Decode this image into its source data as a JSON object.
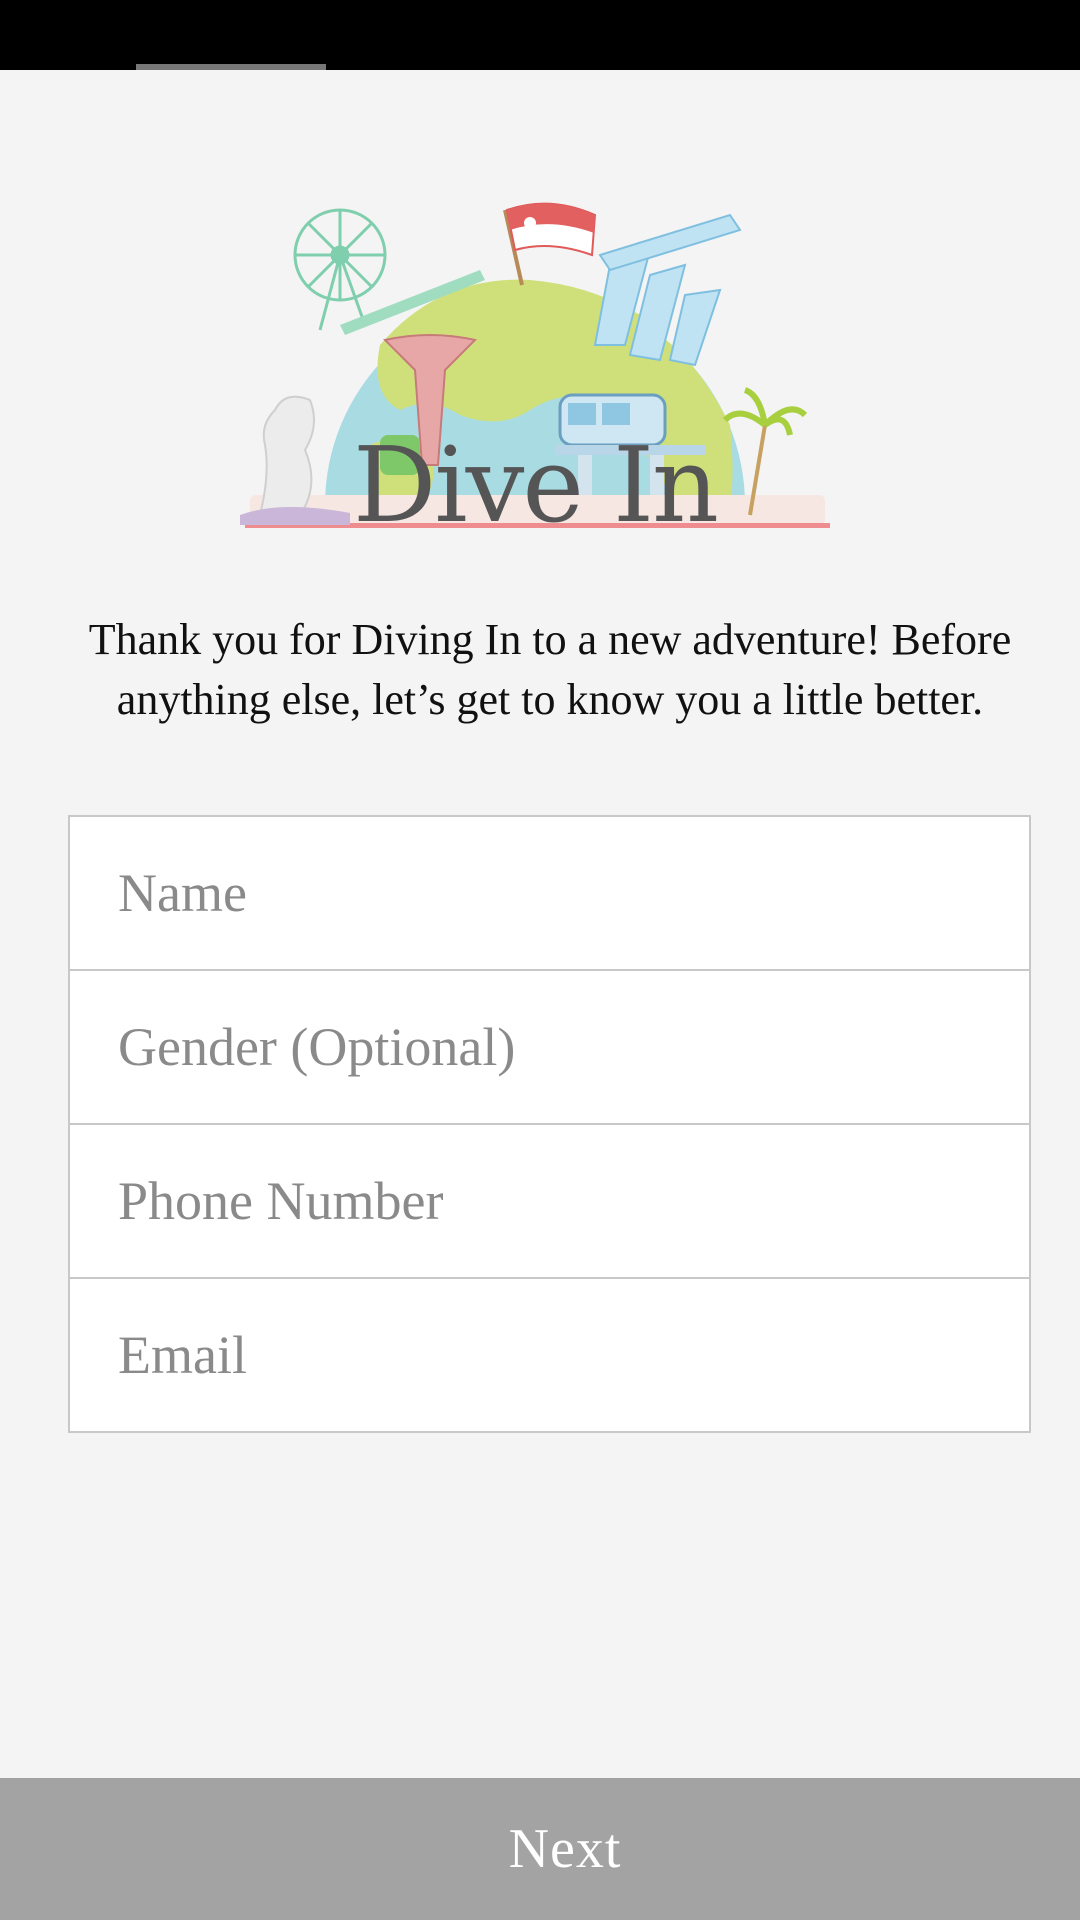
{
  "app": {
    "logo_title": "Dive In",
    "logo_icon": "singapore-landmarks-globe-illustration"
  },
  "intro": {
    "text": "Thank you for Diving In to a new adventure! Before anything else, let’s get to know you a little better."
  },
  "form": {
    "name_placeholder": "Name",
    "gender_placeholder": "Gender (Optional)",
    "phone_placeholder": "Phone Number",
    "email_placeholder": "Email"
  },
  "footer": {
    "next_label": "Next"
  },
  "colors": {
    "background": "#f4f4f4",
    "status_bar": "#000000",
    "button": "#a3a3a3",
    "field_border": "#c8c8c8",
    "placeholder": "#8a8a8a"
  }
}
